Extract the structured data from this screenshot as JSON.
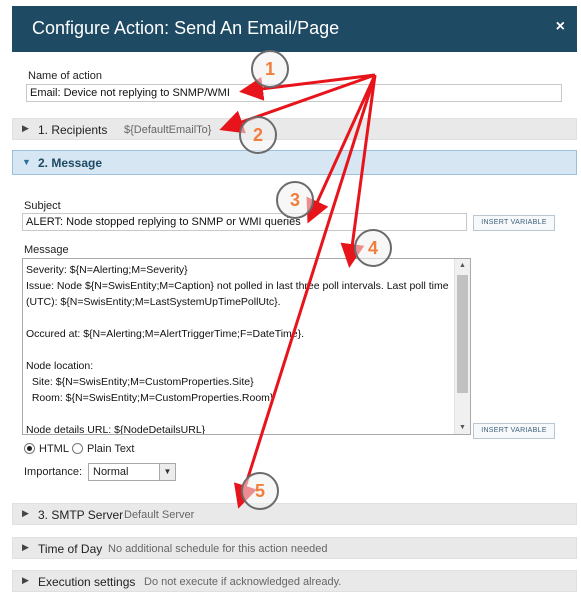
{
  "dialog": {
    "title": "Configure Action: Send An Email/Page",
    "close_label": "×"
  },
  "name_of_action": {
    "label": "Name of action",
    "value": "Email: Device not replying to SNMP/WMI"
  },
  "sections": [
    {
      "number_title": "1. Recipients",
      "subtitle": "${DefaultEmailTo}",
      "expanded": false
    },
    {
      "number_title": "2. Message",
      "subtitle": "",
      "expanded": true
    },
    {
      "number_title": "3. SMTP Server",
      "subtitle": "Default Server",
      "expanded": false
    },
    {
      "number_title": "Time of Day",
      "subtitle": "No additional schedule for this action needed",
      "expanded": false
    },
    {
      "number_title": "Execution settings",
      "subtitle": "Do not execute if acknowledged already.",
      "expanded": false
    }
  ],
  "message": {
    "subject_label": "Subject",
    "subject_value": "ALERT: Node stopped replying to SNMP or WMI queries",
    "insert_variable_label": "INSERT VARIABLE",
    "message_label": "Message",
    "message_body": "Severity: ${N=Alerting;M=Severity}\nIssue: Node ${N=SwisEntity;M=Caption} not polled in last three poll intervals. Last poll time (UTC): ${N=SwisEntity;M=LastSystemUpTimePollUtc}.\n\nOccured at: ${N=Alerting;M=AlertTriggerTime;F=DateTime}.\n\nNode location:\n  Site: ${N=SwisEntity;M=CustomProperties.Site}\n  Room: ${N=SwisEntity;M=CustomProperties.Room}\n\nNode details URL: ${NodeDetailsURL}",
    "format_html_label": "HTML",
    "format_plain_label": "Plain Text",
    "format_selected": "HTML",
    "importance_label": "Importance:",
    "importance_value": "Normal"
  },
  "callouts": [
    "1",
    "2",
    "3",
    "4",
    "5"
  ],
  "colors": {
    "title_bar": "#1e4a63",
    "section_bg": "#e9e9e9",
    "active_section_bg": "#d6e7f3",
    "annotation_arrow": "#e8141c",
    "callout_number": "#f07e3c"
  },
  "icons": {
    "close": "close-icon",
    "collapsed": "chevron-right-icon",
    "expanded": "chevron-down-icon",
    "dropdown": "chevron-down-icon"
  }
}
